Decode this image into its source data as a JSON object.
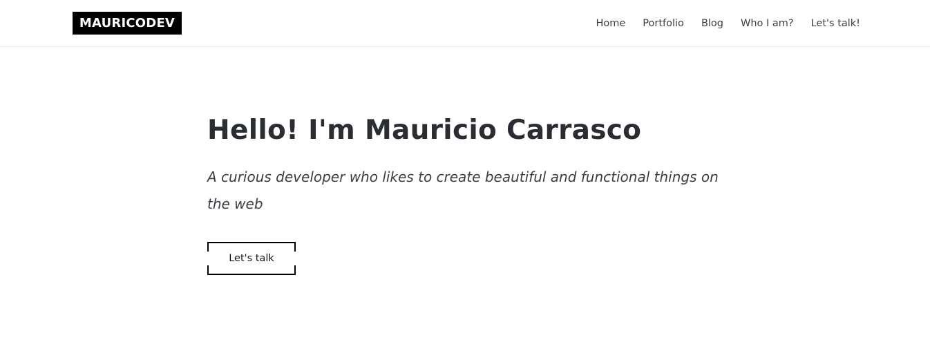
{
  "header": {
    "logo": "MAURICODEV",
    "nav": [
      {
        "label": "Home"
      },
      {
        "label": "Portfolio"
      },
      {
        "label": "Blog"
      },
      {
        "label": "Who I am?"
      },
      {
        "label": "Let's talk!"
      }
    ]
  },
  "hero": {
    "title": "Hello! I'm Mauricio Carrasco",
    "subtitle": "A curious developer who likes to create beautiful and functional things on the web",
    "cta_label": "Let's talk"
  },
  "colors": {
    "logo_background": "#000000",
    "logo_text": "#ffffff",
    "text": "#2a2d31",
    "nav_text": "#3a3f45",
    "header_border": "#ececec"
  }
}
